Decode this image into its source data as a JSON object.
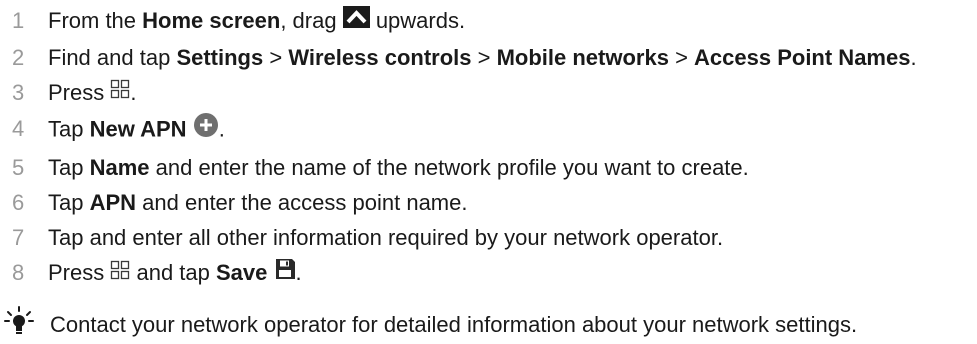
{
  "steps": [
    {
      "num": "1",
      "parts": [
        {
          "t": "From the ",
          "b": false
        },
        {
          "t": "Home screen",
          "b": true
        },
        {
          "t": ", drag ",
          "b": false
        },
        {
          "icon": "arrow-up-icon"
        },
        {
          "t": " upwards.",
          "b": false
        }
      ]
    },
    {
      "num": "2",
      "parts": [
        {
          "t": "Find and tap ",
          "b": false
        },
        {
          "t": "Settings",
          "b": true
        },
        {
          "t": " > ",
          "b": false
        },
        {
          "t": "Wireless controls",
          "b": true
        },
        {
          "t": " > ",
          "b": false
        },
        {
          "t": "Mobile networks",
          "b": true
        },
        {
          "t": " > ",
          "b": false
        },
        {
          "t": "Access Point Names",
          "b": true
        },
        {
          "t": ".",
          "b": false
        }
      ]
    },
    {
      "num": "3",
      "parts": [
        {
          "t": "Press ",
          "b": false
        },
        {
          "icon": "menu-key-icon"
        },
        {
          "t": ".",
          "b": false
        }
      ]
    },
    {
      "num": "4",
      "parts": [
        {
          "t": "Tap ",
          "b": false
        },
        {
          "t": "New APN",
          "b": true
        },
        {
          "t": " ",
          "b": false
        },
        {
          "icon": "add-icon"
        },
        {
          "t": ".",
          "b": false
        }
      ]
    },
    {
      "num": "5",
      "parts": [
        {
          "t": "Tap ",
          "b": false
        },
        {
          "t": "Name",
          "b": true
        },
        {
          "t": " and enter the name of the network profile you want to create.",
          "b": false
        }
      ]
    },
    {
      "num": "6",
      "parts": [
        {
          "t": "Tap ",
          "b": false
        },
        {
          "t": "APN",
          "b": true
        },
        {
          "t": " and enter the access point name.",
          "b": false
        }
      ]
    },
    {
      "num": "7",
      "parts": [
        {
          "t": "Tap and enter all other information required by your network operator.",
          "b": false
        }
      ]
    },
    {
      "num": "8",
      "parts": [
        {
          "t": "Press ",
          "b": false
        },
        {
          "icon": "menu-key-icon"
        },
        {
          "t": " and tap ",
          "b": false
        },
        {
          "t": "Save",
          "b": true
        },
        {
          "t": " ",
          "b": false
        },
        {
          "icon": "save-icon"
        },
        {
          "t": ".",
          "b": false
        }
      ]
    }
  ],
  "tip": {
    "icon": "lightbulb-icon",
    "text": "Contact your network operator for detailed information about your network settings."
  },
  "colors": {
    "step_number": "#9a9a9a",
    "text": "#1a1a1a",
    "arrow_bg": "#1b1b1b",
    "add_icon_bg": "#6f6f6f"
  }
}
